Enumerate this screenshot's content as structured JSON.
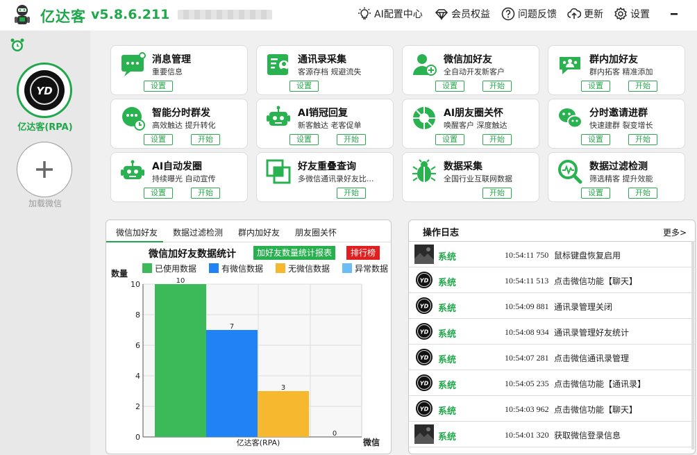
{
  "app": {
    "title": "亿达客",
    "version": "v5.8.6.211"
  },
  "topnav": [
    {
      "label": "AI配置中心",
      "icon": "bulb-icon"
    },
    {
      "label": "会员权益",
      "icon": "diamond-icon"
    },
    {
      "label": "问题反馈",
      "icon": "help-icon"
    },
    {
      "label": "更新",
      "icon": "cloud-upload-icon"
    },
    {
      "label": "设置",
      "icon": "gear-icon"
    }
  ],
  "sidebar": {
    "account_name": "亿达客(RPA)",
    "add_label": "加载微信"
  },
  "cards": [
    {
      "title": "消息管理",
      "subtitle": "重要信息",
      "btn1": "设置",
      "btn2": "",
      "icon": "message-icon"
    },
    {
      "title": "通讯录采集",
      "subtitle": "客源存档 规避流失",
      "btn1": "设置",
      "btn2": "",
      "icon": "contacts-icon"
    },
    {
      "title": "微信加好友",
      "subtitle": "全自动开发新客户",
      "btn1": "设置",
      "btn2": "开始",
      "icon": "add-user-icon"
    },
    {
      "title": "群内加好友",
      "subtitle": "群内拓客 精准添加",
      "btn1": "设置",
      "btn2": "开始",
      "icon": "group-icon"
    },
    {
      "title": "智能分时群发",
      "subtitle": "高效触达 提升转化",
      "btn1": "设置",
      "btn2": "开始",
      "icon": "timed-chat-icon"
    },
    {
      "title": "AI销冠回复",
      "subtitle": "新客触达 老客促单",
      "btn1": "设置",
      "btn2": "开始",
      "icon": "robot-icon"
    },
    {
      "title": "AI朋友圈关怀",
      "subtitle": "唤醒客户 深度触达",
      "btn1": "设置",
      "btn2": "开始",
      "icon": "moments-icon"
    },
    {
      "title": "分时邀请进群",
      "subtitle": "快速建群 裂变增长",
      "btn1": "设置",
      "btn2": "开始",
      "icon": "invite-icon"
    },
    {
      "title": "AI自动发圈",
      "subtitle": "持续曝光 自动宣传",
      "btn1": "设置",
      "btn2": "开始",
      "icon": "robot-post-icon"
    },
    {
      "title": "好友重叠查询",
      "subtitle": "多微信通讯录好友比...",
      "btn1": "",
      "btn2": "开始",
      "icon": "overlap-icon"
    },
    {
      "title": "数据采集",
      "subtitle": "全国行业互联网数据",
      "btn1": "",
      "btn2": "开始",
      "icon": "bug-icon"
    },
    {
      "title": "数据过滤检测",
      "subtitle": "筛选精客 提升效能",
      "btn1": "设置",
      "btn2": "开始",
      "icon": "filter-search-icon"
    }
  ],
  "chart_panel": {
    "tabs": [
      "微信加好友",
      "数据过滤检测",
      "群内加好友",
      "朋友圈关怀"
    ],
    "active_tab": 0,
    "title": "微信加好友数据统计",
    "report_btn": "加好友数量统计报表",
    "rank_btn": "排行榜"
  },
  "chart_data": {
    "type": "bar",
    "title": "微信加好友数据统计",
    "ylabel": "数量",
    "xlabel": "微信",
    "ylim": [
      0,
      10
    ],
    "yticks": [
      0,
      2,
      4,
      6,
      8,
      10
    ],
    "categories": [
      "亿达客(RPA)"
    ],
    "series": [
      {
        "name": "已使用数据",
        "color": "#3cba5a",
        "values": [
          10
        ]
      },
      {
        "name": "有微信数据",
        "color": "#1f83f5",
        "values": [
          7
        ]
      },
      {
        "name": "无微信数据",
        "color": "#f5b82e",
        "values": [
          3
        ]
      },
      {
        "name": "异常数据",
        "color": "#6cbcf5",
        "values": [
          0
        ]
      }
    ],
    "grid": true,
    "legend": "top"
  },
  "log": {
    "title": "操作日志",
    "more": "更多>",
    "rows": [
      {
        "name": "系统",
        "time": "10:54:11 750",
        "msg": "鼠标键盘恢复启用",
        "avatar": "dark-photo"
      },
      {
        "name": "系统",
        "time": "10:54:11 513",
        "msg": "点击微信功能【聊天】",
        "avatar": "logo"
      },
      {
        "name": "系统",
        "time": "10:54:09 881",
        "msg": "通讯录管理关闭",
        "avatar": "logo"
      },
      {
        "name": "系统",
        "time": "10:54:08 934",
        "msg": "通讯录管理好友统计",
        "avatar": "logo"
      },
      {
        "name": "系统",
        "time": "10:54:07 281",
        "msg": "点击微信通讯录管理",
        "avatar": "logo"
      },
      {
        "name": "系统",
        "time": "10:54:05 235",
        "msg": "点击微信功能【通讯录】",
        "avatar": "logo"
      },
      {
        "name": "系统",
        "time": "10:54:03 962",
        "msg": "点击微信功能【聊天】",
        "avatar": "logo"
      },
      {
        "name": "系统",
        "time": "10:54:01 320",
        "msg": "获取微信登录信息",
        "avatar": "dark-photo"
      }
    ]
  }
}
